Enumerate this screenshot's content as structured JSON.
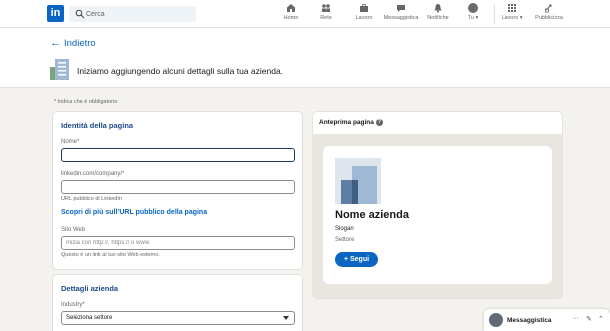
{
  "nav": {
    "logo": "in",
    "search_placeholder": "Cerca",
    "items": [
      {
        "label": "Home",
        "icon": "home-icon"
      },
      {
        "label": "Rete",
        "icon": "network-icon"
      },
      {
        "label": "Lavoro",
        "icon": "briefcase-icon"
      },
      {
        "label": "Messaggistica",
        "icon": "message-icon"
      },
      {
        "label": "Notifiche",
        "icon": "bell-icon"
      },
      {
        "label": "Tu ▾",
        "icon": "avatar"
      },
      {
        "label": "Lavoro ▾",
        "icon": "grid-icon"
      },
      {
        "label": "Pubblicizza",
        "icon": "megaphone-icon"
      }
    ]
  },
  "header": {
    "back_label": "Indietro",
    "intro": "Iniziamo aggiungendo alcuni dettagli sulla tua azienda."
  },
  "form": {
    "required_note": "* Indica che è obbligatorio",
    "identity_title": "Identità della pagina",
    "name_label": "Nome*",
    "name_value": "",
    "url_label": "linkedin.com/company/*",
    "url_value": "",
    "url_hint": "URL pubblico di LinkedIn",
    "url_link": "Scopri di più sull’URL pubblico della pagina",
    "website_label": "Sito Web",
    "website_placeholder": "Inizia con http://, https:// o www.",
    "website_hint": "Questo è un link al tuo sito Web esterno.",
    "details_title": "Dettagli azienda",
    "industry_label": "Industry*",
    "industry_selected": "Seleziona settore"
  },
  "preview": {
    "title": "Anteprima pagina",
    "company_name": "Nome azienda",
    "slogan": "Slogan",
    "sector": "Settore",
    "follow_label": "+ Segui"
  },
  "messaging": {
    "label": "Messaggistica",
    "controls": [
      "···",
      "✎",
      "⌃"
    ]
  },
  "colors": {
    "brand": "#0a66c2",
    "section_title": "#1d4a88",
    "background": "#f3f2ef"
  }
}
